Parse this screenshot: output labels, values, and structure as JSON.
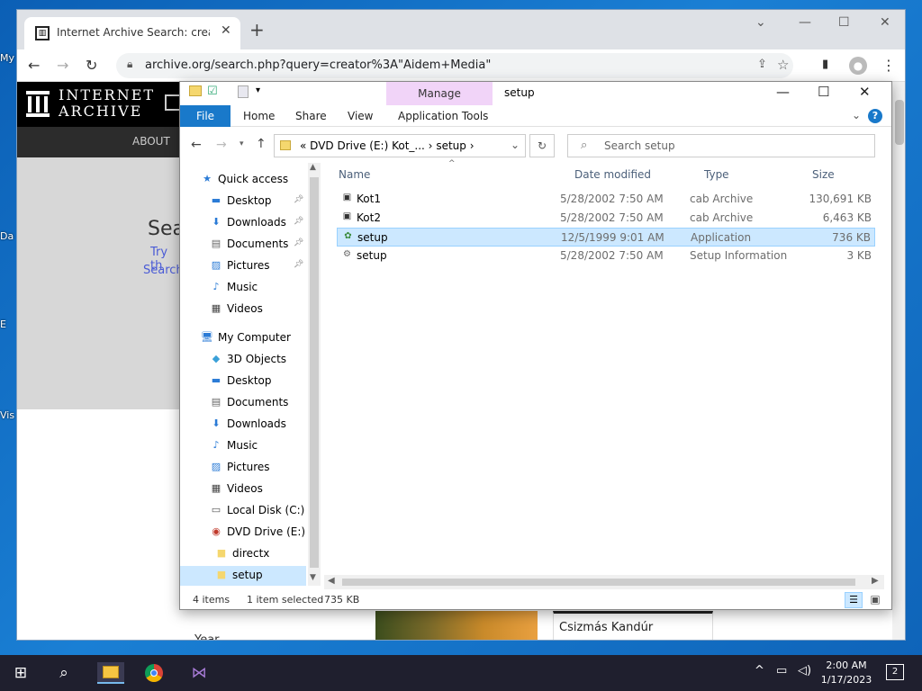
{
  "desktop": {
    "labels": [
      "My",
      "Da",
      "E",
      "Vis"
    ]
  },
  "browser": {
    "tab_title": "Internet Archive Search: creator:\"Aidem Media\"",
    "url": "archive.org/search.php?query=creator%3A\"Aidem+Media\"",
    "new_tab": "+",
    "page": {
      "logo_line1": "INTERNET",
      "logo_line2": "ARCHIVE",
      "about": "ABOUT",
      "search_heading": "Sea",
      "try_text": "Try th",
      "search_text": "Search",
      "year_label": "Year",
      "card_title": "Csizmás Kandúr"
    }
  },
  "explorer": {
    "title": "setup",
    "manage": "Manage",
    "tabs": {
      "file": "File",
      "home": "Home",
      "share": "Share",
      "view": "View",
      "app_tools": "Application Tools"
    },
    "address": {
      "prefix": "«",
      "part1": "DVD Drive (E:) Kot_...",
      "sep1": "›",
      "part2": "setup",
      "sep2": "›"
    },
    "search_placeholder": "Search setup",
    "nav": [
      {
        "label": "Quick access",
        "icon": "star-icon",
        "indent": 0
      },
      {
        "label": "Desktop",
        "icon": "desktop-icon",
        "indent": 1,
        "pinned": true
      },
      {
        "label": "Downloads",
        "icon": "download-icon",
        "indent": 1,
        "pinned": true
      },
      {
        "label": "Documents",
        "icon": "document-icon",
        "indent": 1,
        "pinned": true
      },
      {
        "label": "Pictures",
        "icon": "picture-icon",
        "indent": 1,
        "pinned": true
      },
      {
        "label": "Music",
        "icon": "music-icon",
        "indent": 1
      },
      {
        "label": "Videos",
        "icon": "video-icon",
        "indent": 1
      },
      {
        "label": "My Computer",
        "icon": "computer-icon",
        "indent": 0
      },
      {
        "label": "3D Objects",
        "icon": "cube-icon",
        "indent": 1
      },
      {
        "label": "Desktop",
        "icon": "desktop-icon",
        "indent": 1
      },
      {
        "label": "Documents",
        "icon": "document-icon",
        "indent": 1
      },
      {
        "label": "Downloads",
        "icon": "download-icon",
        "indent": 1
      },
      {
        "label": "Music",
        "icon": "music-icon",
        "indent": 1
      },
      {
        "label": "Pictures",
        "icon": "picture-icon",
        "indent": 1
      },
      {
        "label": "Videos",
        "icon": "video-icon",
        "indent": 1
      },
      {
        "label": "Local Disk (C:)",
        "icon": "disk-icon",
        "indent": 1
      },
      {
        "label": "DVD Drive (E:) Ko",
        "icon": "dvd-icon",
        "indent": 1
      },
      {
        "label": "directx",
        "icon": "folder-icon",
        "indent": 2
      },
      {
        "label": "setup",
        "icon": "folder-icon",
        "indent": 2,
        "selected": true
      }
    ],
    "columns": {
      "name": "Name",
      "date": "Date modified",
      "type": "Type",
      "size": "Size"
    },
    "files": [
      {
        "name": "Kot1",
        "date": "5/28/2002 7:50 AM",
        "type": "cab Archive",
        "size": "130,691 KB",
        "icon": "cab-icon"
      },
      {
        "name": "Kot2",
        "date": "5/28/2002 7:50 AM",
        "type": "cab Archive",
        "size": "6,463 KB",
        "icon": "cab-icon"
      },
      {
        "name": "setup",
        "date": "12/5/1999 9:01 AM",
        "type": "Application",
        "size": "736 KB",
        "icon": "application-icon",
        "selected": true
      },
      {
        "name": "setup",
        "date": "5/28/2002 7:50 AM",
        "type": "Setup Information",
        "size": "3 KB",
        "icon": "setup-info-icon"
      }
    ],
    "status": {
      "items": "4 items",
      "selected": "1 item selected",
      "size": "735 KB"
    }
  },
  "taskbar": {
    "time": "2:00 AM",
    "date": "1/17/2023",
    "notifications": "2"
  }
}
